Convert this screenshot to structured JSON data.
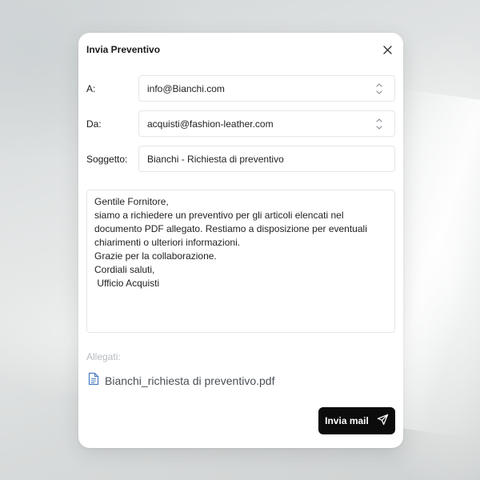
{
  "dialog": {
    "title": "Invia Preventivo"
  },
  "form": {
    "to_label": "A:",
    "to_value": "info@Bianchi.com",
    "from_label": "Da:",
    "from_value": "acquisti@fashion-leather.com",
    "subject_label": "Soggetto:",
    "subject_value": "Bianchi - Richiesta di preventivo"
  },
  "message": {
    "lines": [
      "Gentile Fornitore,",
      "",
      "siamo a richiedere un preventivo per gli articoli elencati nel",
      "documento PDF allegato. Restiamo a disposizione per eventuali",
      "chiarimenti o ulteriori informazioni.",
      "",
      "Grazie per la collaborazione.",
      "",
      "Cordiali saluti,",
      " Ufficio Acquisti"
    ]
  },
  "attachments": {
    "label": "Allegati:",
    "files": [
      {
        "name": "Bianchi_richiesta di preventivo.pdf",
        "icon": "pdf-file-icon"
      }
    ]
  },
  "actions": {
    "send_label": "Invia mail",
    "send_icon": "paper-plane-icon"
  },
  "colors": {
    "send_button": "#0c0c0c",
    "file_icon": "#4a7bbf",
    "muted_label": "#b7bcc0"
  }
}
